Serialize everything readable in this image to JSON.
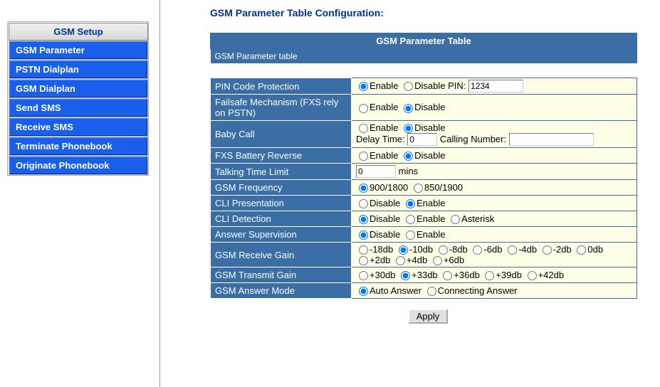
{
  "sidebar": {
    "header": "GSM Setup",
    "items": [
      "GSM Parameter",
      "PSTN Dialplan",
      "GSM Dialplan",
      "Send SMS",
      "Receive SMS",
      "Terminate Phonebook",
      "Originate Phonebook"
    ]
  },
  "page": {
    "title": "GSM Parameter Table Configuration:",
    "table_title": "GSM Parameter Table",
    "table_subtitle": "GSM Parameter table",
    "apply": "Apply"
  },
  "rows": {
    "pin": {
      "label": "PIN Code Protection",
      "opt_enable": "Enable",
      "opt_disable": "Disable",
      "pin_label": "PIN:",
      "pin_value": "1234"
    },
    "failsafe": {
      "label": "Failsafe Mechanism (FXS rely on PSTN)",
      "opt_enable": "Enable",
      "opt_disable": "Disable"
    },
    "babycall": {
      "label": "Baby Call",
      "opt_enable": "Enable",
      "opt_disable": "Disable",
      "delay_label": "Delay Time:",
      "delay_value": "0",
      "calling_label": "Calling Number:",
      "calling_value": ""
    },
    "fxs": {
      "label": "FXS Battery Reverse",
      "opt_enable": "Enable",
      "opt_disable": "Disable"
    },
    "talk": {
      "label": "Talking Time Limit",
      "value": "0",
      "unit": "mins"
    },
    "freq": {
      "label": "GSM Frequency",
      "opt1": "900/1800",
      "opt2": "850/1900"
    },
    "clip": {
      "label": "CLI Presentation",
      "opt_disable": "Disable",
      "opt_enable": "Enable"
    },
    "clid": {
      "label": "CLI Detection",
      "opt_disable": "Disable",
      "opt_enable": "Enable",
      "opt_asterisk": "Asterisk"
    },
    "ans": {
      "label": "Answer Supervision",
      "opt_disable": "Disable",
      "opt_enable": "Enable"
    },
    "rxgain": {
      "label": "GSM Receive Gain",
      "opts": [
        "-18db",
        "-10db",
        "-8db",
        "-6db",
        "-4db",
        "-2db",
        "0db",
        "+2db",
        "+4db",
        "+6db"
      ]
    },
    "txgain": {
      "label": "GSM Transmit Gain",
      "opts": [
        "+30db",
        "+33db",
        "+36db",
        "+39db",
        "+42db"
      ]
    },
    "ansmode": {
      "label": "GSM Answer Mode",
      "opt_auto": "Auto Answer",
      "opt_conn": "Connecting Answer"
    }
  }
}
